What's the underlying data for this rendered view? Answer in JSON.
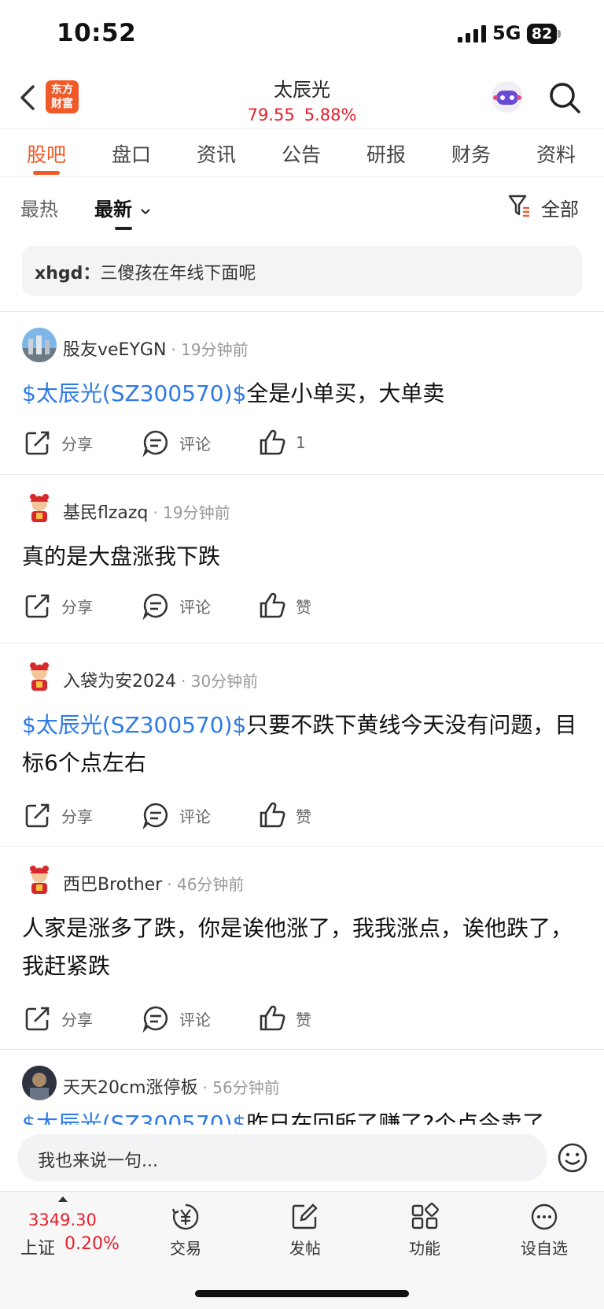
{
  "status_bar": {
    "time": "10:52",
    "network": "5G",
    "battery": "82"
  },
  "header": {
    "logo_line1": "东方",
    "logo_line2": "财富",
    "title": "太辰光",
    "price": "79.55",
    "change_pct": "5.88%",
    "quote_color": "#e6202b"
  },
  "tabs": [
    {
      "label": "股吧",
      "active": true
    },
    {
      "label": "盘口"
    },
    {
      "label": "资讯"
    },
    {
      "label": "公告"
    },
    {
      "label": "研报"
    },
    {
      "label": "财务"
    },
    {
      "label": "资料"
    }
  ],
  "sort": {
    "hot": "最热",
    "latest": "最新",
    "filter": "全部"
  },
  "pinned": {
    "user": "xhgd：",
    "text": "三傻孩在年线下面呢"
  },
  "posts": [
    {
      "user": "股友veEYGN",
      "time": "19分钟前",
      "stock_tag": "$太辰光(SZ300570)$",
      "text": "全是小单买，大单卖",
      "share": "分享",
      "comment": "评论",
      "like": "1"
    },
    {
      "user": "基民flzazq",
      "time": "19分钟前",
      "stock_tag": "",
      "text": "真的是大盘涨我下跌",
      "share": "分享",
      "comment": "评论",
      "like": "赞"
    },
    {
      "user": "入袋为安2024",
      "time": "30分钟前",
      "stock_tag": "$太辰光(SZ300570)$",
      "text": "只要不跌下黄线今天没有问题，目标6个点左右",
      "share": "分享",
      "comment": "评论",
      "like": "赞"
    },
    {
      "user": "西巴Brother",
      "time": "46分钟前",
      "stock_tag": "",
      "text": "人家是涨多了跌，你是诶他涨了，我我涨点，诶他跌了，我赶紧跌",
      "share": "分享",
      "comment": "评论",
      "like": "赞"
    },
    {
      "user": "天天20cm涨停板",
      "time": "56分钟前",
      "stock_tag": "$太辰光(SZ300570)$",
      "text": "昨日在回所了赚了?个点今卖了",
      "share": "",
      "comment": "",
      "like": ""
    }
  ],
  "comment_bar": {
    "placeholder": "我也来说一句..."
  },
  "bottom_nav": {
    "index_value": "3349.30",
    "index_name": "上证",
    "index_pct": "0.20%",
    "items": [
      {
        "label": "交易"
      },
      {
        "label": "发帖"
      },
      {
        "label": "功能"
      },
      {
        "label": "设自选"
      }
    ]
  },
  "colors": {
    "accent": "#f05a28",
    "link": "#2f7be6",
    "up": "#e6202b"
  },
  "icons": {
    "back": "chevron-left-icon",
    "search": "search-icon",
    "filter": "filter-icon",
    "share": "share-icon",
    "comment": "comment-icon",
    "like": "thumbs-up-icon",
    "emoji": "emoji-icon",
    "trade": "yen-icon",
    "post": "edit-icon",
    "function": "grid-icon",
    "watchlist": "more-icon"
  }
}
